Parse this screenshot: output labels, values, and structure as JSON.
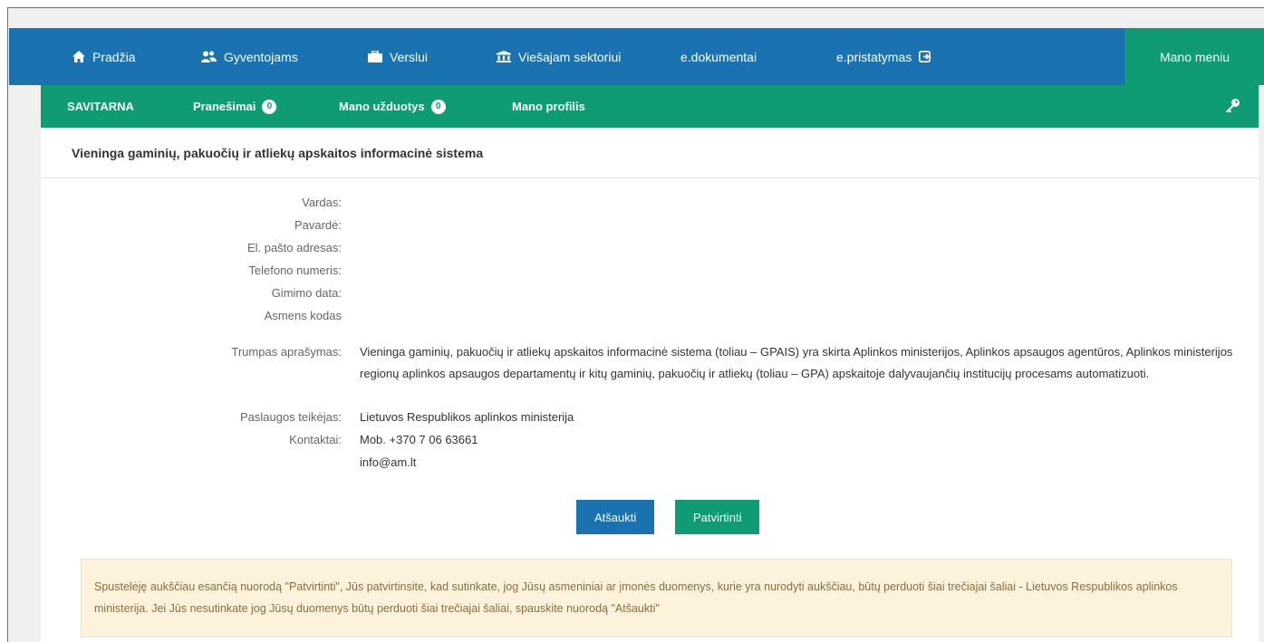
{
  "topnav": {
    "items": [
      {
        "label": "Pradžia",
        "icon": "home-icon"
      },
      {
        "label": "Gyventojams",
        "icon": "users-icon"
      },
      {
        "label": "Verslui",
        "icon": "briefcase-icon"
      },
      {
        "label": "Viešajam sektoriui",
        "icon": "institution-icon"
      },
      {
        "label": "e.dokumentai"
      },
      {
        "label": "e.pristatymas",
        "icon": "external-link-icon"
      }
    ],
    "menu_label": "Mano meniu"
  },
  "subnav": {
    "brand": "SAVITARNA",
    "items": [
      {
        "label": "Pranešimai",
        "count": "0"
      },
      {
        "label": "Mano užduotys",
        "count": "0"
      },
      {
        "label": "Mano profilis"
      }
    ],
    "key_icon": "key-icon"
  },
  "panel": {
    "title": "Vieninga gaminių, pakuočių ir atliekų apskaitos informacinė sistema",
    "fields": {
      "vardas": "Vardas:",
      "pavarde": "Pavardė:",
      "email": "El. pašto adresas:",
      "phone": "Telefono numeris:",
      "birth": "Gimimo data:",
      "code": "Asmens kodas"
    },
    "description_label": "Trumpas aprašymas:",
    "description": "Vieninga gaminių, pakuočių ir atliekų apskaitos informacinė sistema (toliau – GPAIS) yra skirta Aplinkos ministerijos, Aplinkos apsaugos agentūros, Aplinkos ministerijos regionų aplinkos apsaugos departamentų ir kitų gaminių, pakuočių ir atliekų (toliau – GPA) apskaitoje dalyvaujančių institucijų procesams automatizuoti.",
    "provider_label": "Paslaugos teikėjas:",
    "provider": "Lietuvos Respublikos aplinkos ministerija",
    "contacts_label": "Kontaktai:",
    "contact_phone": "Mob. +370 7 06 63661",
    "contact_email": "info@am.lt",
    "cancel_label": "Atšaukti",
    "confirm_label": "Patvirtinti",
    "notice": "Spustelėję aukščiau esančią nuorodą \"Patvirtinti\", Jūs patvirtinsite, kad sutinkate, jog Jūsų asmeniniai ar įmonės duomenys, kurie yra nurodyti aukščiau, būtų perduoti šiai trečiajai šaliai - Lietuvos Respublikos aplinkos ministerija. Jei Jūs nesutinkate jog Jūsų duomenys būtų perduoti šiai trečiajai šaliai, spauskite nuorodą \"Atšaukti\""
  },
  "colors": {
    "blue": "#1a73b0",
    "green": "#0f9b73",
    "notice_bg": "#fdf3dd"
  }
}
